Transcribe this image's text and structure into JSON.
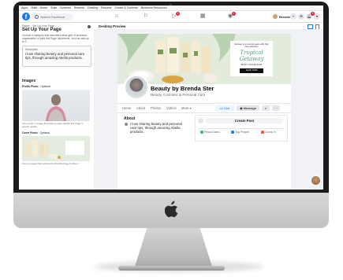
{
  "bookmarks": [
    "Apps",
    "Suite - Home",
    "Suite - Contests",
    "Resume",
    "Desking",
    "Resume",
    "Create & Contests",
    "Business Resources"
  ],
  "fb": {
    "logo": "f",
    "search_placeholder": "Search Facebook",
    "profile_name": "Brenda",
    "notif_badge": "5",
    "msg_badge": "1",
    "groups_badge": "9",
    "plus_label": "+",
    "menu_label": "▾"
  },
  "setup": {
    "breadcrumb": "Pages · Set Up Your Page",
    "title": "Set Up Your Page",
    "desc_help": "Choose a category that describes what type of business, organization or topic the Page represents. You can add up to 3.",
    "desc_label": "Description",
    "desc_value": "I love sharing beauty and personal care tips, through amazing Abella products.",
    "images_heading": "Images",
    "profile_photo_label": "Profile Photo",
    "profile_photo_optional": "· Optional",
    "profile_caption": "Use a logo or image that helps people identify this Page in search results.",
    "cover_photo_label": "Cover Photo",
    "cover_photo_optional": "· Optional",
    "cover_caption": "Use an image that represents what the Page is about."
  },
  "preview": {
    "label": "Desktop Preview",
    "promo_small": "Escape to a tropical oasis with this new collection",
    "promo_script": "Tropical Getaway",
    "promo_collection": "BODY COLLECTION",
    "promo_button": "SHOP NOW",
    "page_name": "Beauty by Brenda Ster",
    "page_category": "Beauty, Cosmetic & Personal Care",
    "tabs": [
      "Home",
      "About",
      "Photos",
      "Videos",
      "More ▾"
    ],
    "like_button": "Like",
    "message_button": "Message",
    "about_title": "About",
    "about_text": "I love sharing beauty and personal care tips, through amazing Abella products.",
    "create_post": "Create Post",
    "post_actions": [
      "Photo/Video",
      "Tag People",
      "Check In"
    ]
  },
  "colors": {
    "accent": "#1877f2",
    "badge": "#e41e3f"
  }
}
